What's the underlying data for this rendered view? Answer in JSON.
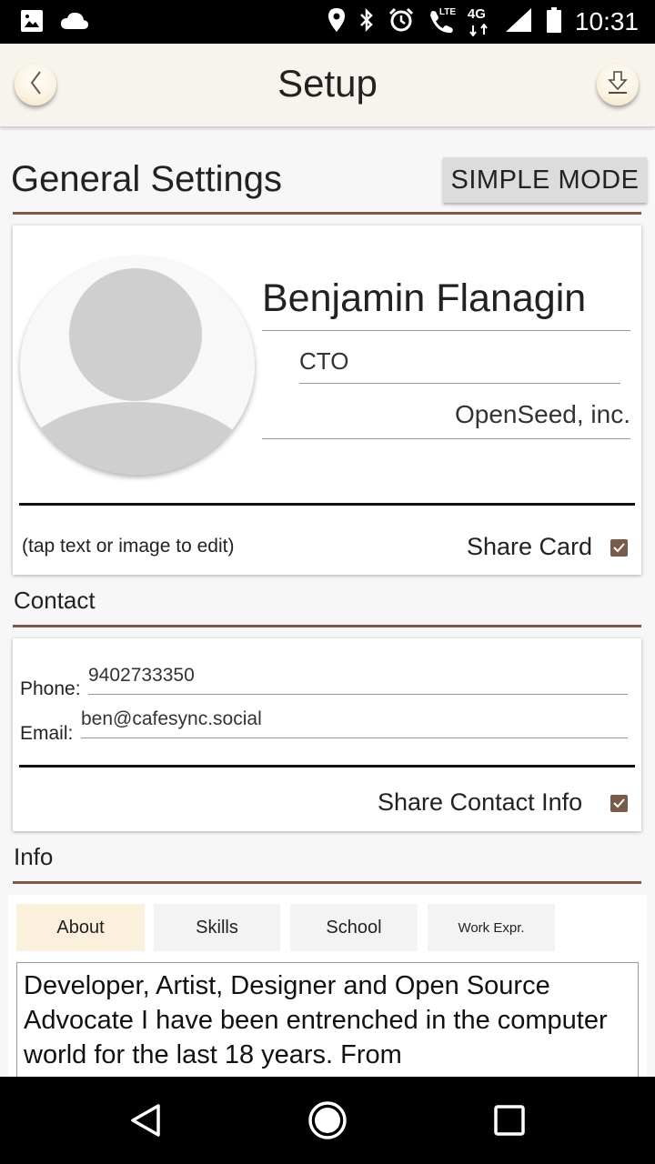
{
  "status_bar": {
    "time": "10:31",
    "network_label": "4G",
    "lte_label": "LTE",
    "icons": [
      "image-icon",
      "cloud-icon",
      "location-icon",
      "bluetooth-icon",
      "alarm-icon",
      "wifi-call-icon",
      "signal-icon",
      "battery-icon"
    ]
  },
  "app_bar": {
    "title": "Setup",
    "back_icon": "chevron-left-icon",
    "download_icon": "download-icon"
  },
  "general": {
    "title": "General Settings",
    "mode_button": "SIMPLE MODE"
  },
  "profile": {
    "name": "Benjamin Flanagin",
    "job_title": "CTO",
    "company": "OpenSeed, inc.",
    "hint": "(tap text or image to edit)",
    "share_label": "Share Card",
    "share_checked": true
  },
  "contact": {
    "title": "Contact",
    "phone_label": "Phone:",
    "phone_value": "9402733350",
    "email_label": "Email:",
    "email_value": "ben@cafesync.social",
    "share_label": "Share Contact Info",
    "share_checked": true
  },
  "info": {
    "title": "Info",
    "tabs": [
      {
        "label": "About",
        "active": true
      },
      {
        "label": "Skills",
        "active": false
      },
      {
        "label": "School",
        "active": false
      },
      {
        "label": "Work Expr.",
        "active": false
      }
    ],
    "about_text": "Developer, Artist, Designer and Open Source Advocate I have been entrenched in the computer world for the last 18 years. From"
  },
  "colors": {
    "accent_brown": "#7a5a4a",
    "active_tab": "#fbf0dc",
    "app_bar_bg": "#f6f4ec"
  },
  "nav_bar": {
    "icons": [
      "back-triangle-icon",
      "home-circle-icon",
      "recents-square-icon"
    ]
  }
}
